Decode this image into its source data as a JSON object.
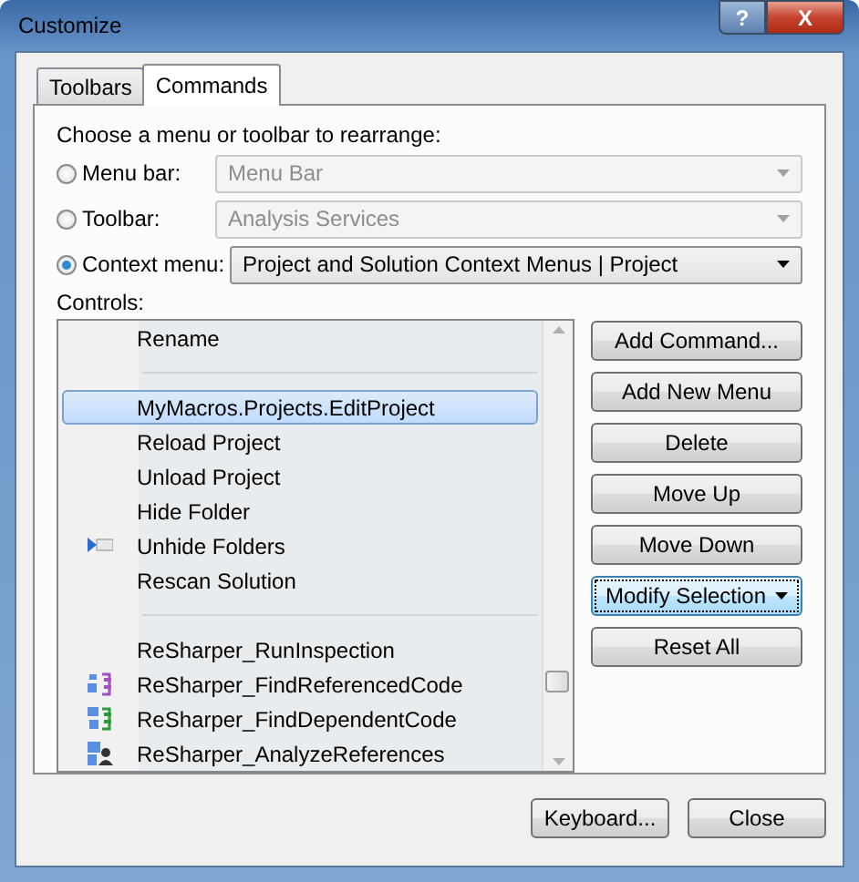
{
  "window": {
    "title": "Customize"
  },
  "title_buttons": [
    {
      "kind": "help",
      "label": "?"
    },
    {
      "kind": "close",
      "label": "X"
    }
  ],
  "tabs": [
    {
      "label": "Toolbars",
      "selected": false
    },
    {
      "label": "Commands",
      "selected": true
    }
  ],
  "choose_label": "Choose a menu or toolbar to rearrange:",
  "targets": [
    {
      "label": "Menu bar:",
      "value": "Menu Bar",
      "selected": false,
      "disabled": true
    },
    {
      "label": "Toolbar:",
      "value": "Analysis Services",
      "selected": false,
      "disabled": true
    },
    {
      "label": "Context menu:",
      "value": "Project and Solution Context Menus | Project",
      "selected": true,
      "disabled": false
    }
  ],
  "controls_label": "Controls:",
  "controls": [
    {
      "kind": "command",
      "label": "Rename",
      "selected": false
    },
    {
      "kind": "separator"
    },
    {
      "kind": "command",
      "label": "MyMacros.Projects.EditProject",
      "selected": true
    },
    {
      "kind": "command",
      "label": "Reload Project",
      "selected": false
    },
    {
      "kind": "command",
      "label": "Unload Project",
      "selected": false
    },
    {
      "kind": "command",
      "label": "Hide Folder",
      "selected": false
    },
    {
      "kind": "command",
      "label": "Unhide Folders",
      "selected": false,
      "has_icon": true
    },
    {
      "kind": "command",
      "label": "Rescan Solution",
      "selected": false
    },
    {
      "kind": "separator"
    },
    {
      "kind": "command",
      "label": "ReSharper_RunInspection",
      "selected": false
    },
    {
      "kind": "command",
      "label": "ReSharper_FindReferencedCode",
      "selected": false,
      "has_icon": true
    },
    {
      "kind": "command",
      "label": "ReSharper_FindDependentCode",
      "selected": false,
      "has_icon": true
    },
    {
      "kind": "command",
      "label": "ReSharper_AnalyzeReferences",
      "selected": false,
      "has_icon": true
    }
  ],
  "actions": [
    {
      "label": "Add Command...",
      "focused": false,
      "dropdown": false
    },
    {
      "label": "Add New Menu",
      "focused": false,
      "dropdown": false
    },
    {
      "label": "Delete",
      "focused": false,
      "dropdown": false
    },
    {
      "label": "Move Up",
      "focused": false,
      "dropdown": false
    },
    {
      "label": "Move Down",
      "focused": false,
      "dropdown": false
    },
    {
      "label": "Modify Selection",
      "focused": true,
      "dropdown": true
    },
    {
      "label": "Reset All",
      "focused": false,
      "dropdown": false
    }
  ],
  "footer_buttons": [
    "Keyboard...",
    "Close"
  ]
}
